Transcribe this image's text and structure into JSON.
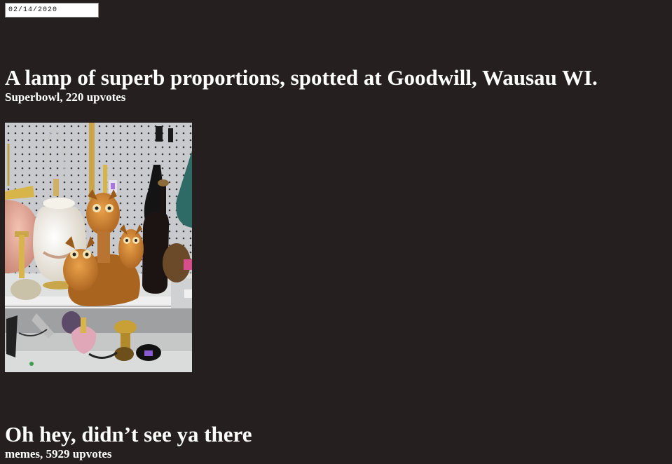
{
  "date_filter": {
    "value": "02/14/2020"
  },
  "posts": [
    {
      "title": "A lamp of superb proportions, spotted at Goodwill, Wausau WI.",
      "meta": "Superbowl, 220 upvotes"
    },
    {
      "title": "Oh hey, didn’t see ya there",
      "meta": "memes, 5929 upvotes"
    }
  ]
}
